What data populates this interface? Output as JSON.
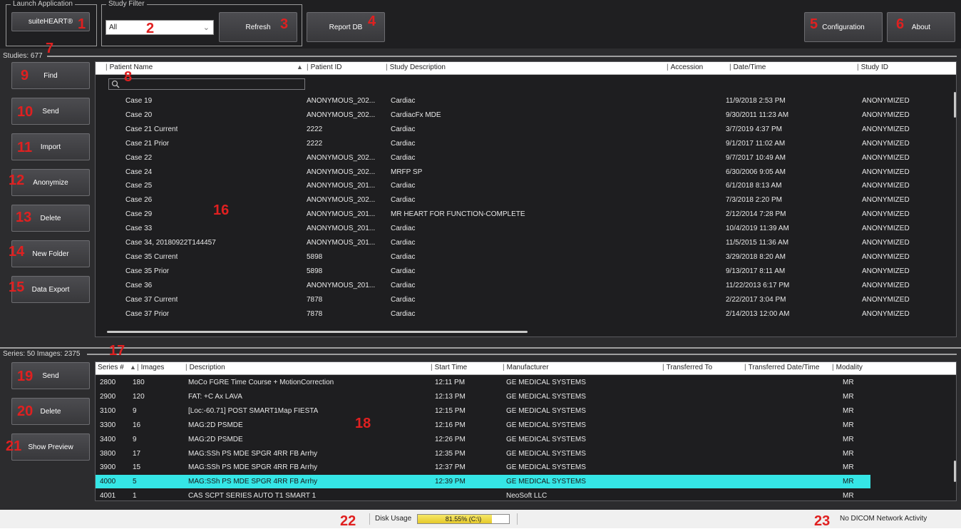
{
  "toolbar": {
    "launch_group_title": "Launch Application",
    "launch_button": "suiteHEART®",
    "filter_group_title": "Study Filter",
    "filter_value": "All",
    "refresh_button": "Refresh",
    "report_db_button": "Report DB",
    "configuration_button": "Configuration",
    "about_button": "About"
  },
  "studies": {
    "label": "Studies: 677",
    "buttons": {
      "find": "Find",
      "send": "Send",
      "import": "Import",
      "anonymize": "Anonymize",
      "delete": "Delete",
      "new_folder": "New Folder",
      "data_export": "Data Export"
    },
    "columns": [
      "Patient Name",
      "Patient ID",
      "Study Description",
      "Accession",
      "Date/Time",
      "Study ID"
    ],
    "sort_indicator": "▲",
    "rows": [
      [
        "Case 19",
        "ANONYMOUS_202...",
        "Cardiac",
        "",
        "11/9/2018 2:53 PM",
        "ANONYMIZED"
      ],
      [
        "Case 20",
        "ANONYMOUS_202...",
        "CardiacFx MDE",
        "",
        "9/30/2011 11:23 AM",
        "ANONYMIZED"
      ],
      [
        "Case 21 Current",
        "2222",
        "Cardiac",
        "",
        "3/7/2019 4:37 PM",
        "ANONYMIZED"
      ],
      [
        "Case 21 Prior",
        "2222",
        "Cardiac",
        "",
        "9/1/2017 11:02 AM",
        "ANONYMIZED"
      ],
      [
        "Case 22",
        "ANONYMOUS_202...",
        "Cardiac",
        "",
        "9/7/2017 10:49 AM",
        "ANONYMIZED"
      ],
      [
        "Case 24",
        "ANONYMOUS_202...",
        "MRFP SP",
        "",
        "6/30/2006 9:05 AM",
        "ANONYMIZED"
      ],
      [
        "Case 25",
        "ANONYMOUS_201...",
        "Cardiac",
        "",
        "6/1/2018 8:13 AM",
        "ANONYMIZED"
      ],
      [
        "Case 26",
        "ANONYMOUS_202...",
        "Cardiac",
        "",
        "7/3/2018 2:20 PM",
        "ANONYMIZED"
      ],
      [
        "Case 29",
        "ANONYMOUS_201...",
        "MR HEART FOR FUNCTION-COMPLETE",
        "",
        "2/12/2014 7:28 PM",
        "ANONYMIZED"
      ],
      [
        "Case 33",
        "ANONYMOUS_201...",
        "Cardiac",
        "",
        "10/4/2019 11:39 AM",
        "ANONYMIZED"
      ],
      [
        "Case 34, 20180922T144457",
        "ANONYMOUS_201...",
        "Cardiac",
        "",
        "11/5/2015 11:36 AM",
        "ANONYMIZED"
      ],
      [
        "Case 35 Current",
        "5898",
        "Cardiac",
        "",
        "3/29/2018 8:20 AM",
        "ANONYMIZED"
      ],
      [
        "Case 35 Prior",
        "5898",
        "Cardiac",
        "",
        "9/13/2017 8:11 AM",
        "ANONYMIZED"
      ],
      [
        "Case 36",
        "ANONYMOUS_201...",
        "Cardiac",
        "",
        "11/22/2013 6:17 PM",
        "ANONYMIZED"
      ],
      [
        "Case 37 Current",
        "7878",
        "Cardiac",
        "",
        "2/22/2017 3:04 PM",
        "ANONYMIZED"
      ],
      [
        "Case 37 Prior",
        "7878",
        "Cardiac",
        "",
        "2/14/2013 12:00 AM",
        "ANONYMIZED"
      ]
    ]
  },
  "series": {
    "label": "Series: 50  Images: 2375",
    "buttons": {
      "send": "Send",
      "delete": "Delete",
      "show_preview": "Show Preview"
    },
    "columns": [
      "Series #",
      "Images",
      "Description",
      "Start Time",
      "Manufacturer",
      "Transferred To",
      "Transferred Date/Time",
      "Modality"
    ],
    "sort_indicator": "▲",
    "rows": [
      [
        "2800",
        "180",
        "MoCo FGRE Time Course + MotionCorrection",
        "12:11 PM",
        "GE MEDICAL SYSTEMS",
        "",
        "",
        "MR"
      ],
      [
        "2900",
        "120",
        "FAT: +C Ax LAVA",
        "12:13 PM",
        "GE MEDICAL SYSTEMS",
        "",
        "",
        "MR"
      ],
      [
        "3100",
        "9",
        "[Loc:-60.71] POST SMART1Map FIESTA",
        "12:15 PM",
        "GE MEDICAL SYSTEMS",
        "",
        "",
        "MR"
      ],
      [
        "3300",
        "16",
        "MAG:2D PSMDE",
        "12:16 PM",
        "GE MEDICAL SYSTEMS",
        "",
        "",
        "MR"
      ],
      [
        "3400",
        "9",
        "MAG:2D PSMDE",
        "12:26 PM",
        "GE MEDICAL SYSTEMS",
        "",
        "",
        "MR"
      ],
      [
        "3800",
        "17",
        "MAG:SSh PS MDE SPGR 4RR FB Arrhy",
        "12:35 PM",
        "GE MEDICAL SYSTEMS",
        "",
        "",
        "MR"
      ],
      [
        "3900",
        "15",
        "MAG:SSh PS MDE SPGR 4RR FB Arrhy",
        "12:37 PM",
        "GE MEDICAL SYSTEMS",
        "",
        "",
        "MR"
      ],
      [
        "4000",
        "5",
        "MAG:SSh PS MDE SPGR 4RR FB Arrhy",
        "12:39 PM",
        "GE MEDICAL SYSTEMS",
        "",
        "",
        "MR"
      ],
      [
        "4001",
        "1",
        "CAS SCPT SERIES AUTO T1 SMART 1",
        "",
        "NeoSoft LLC",
        "",
        "",
        "MR"
      ]
    ],
    "selected_index": 7
  },
  "status": {
    "disk_label": "Disk Usage",
    "disk_value": "81.55% (C:\\)",
    "disk_fraction": 0.8155,
    "network_text": "No DICOM Network Activity"
  },
  "callouts": [
    "1",
    "2",
    "3",
    "4",
    "5",
    "6",
    "7",
    "8",
    "9",
    "10",
    "11",
    "12",
    "13",
    "14",
    "15",
    "16",
    "17",
    "18",
    "19",
    "20",
    "21",
    "22",
    "23"
  ],
  "icons": {
    "search": "search-icon",
    "dropdown": "chevron-down-icon"
  }
}
